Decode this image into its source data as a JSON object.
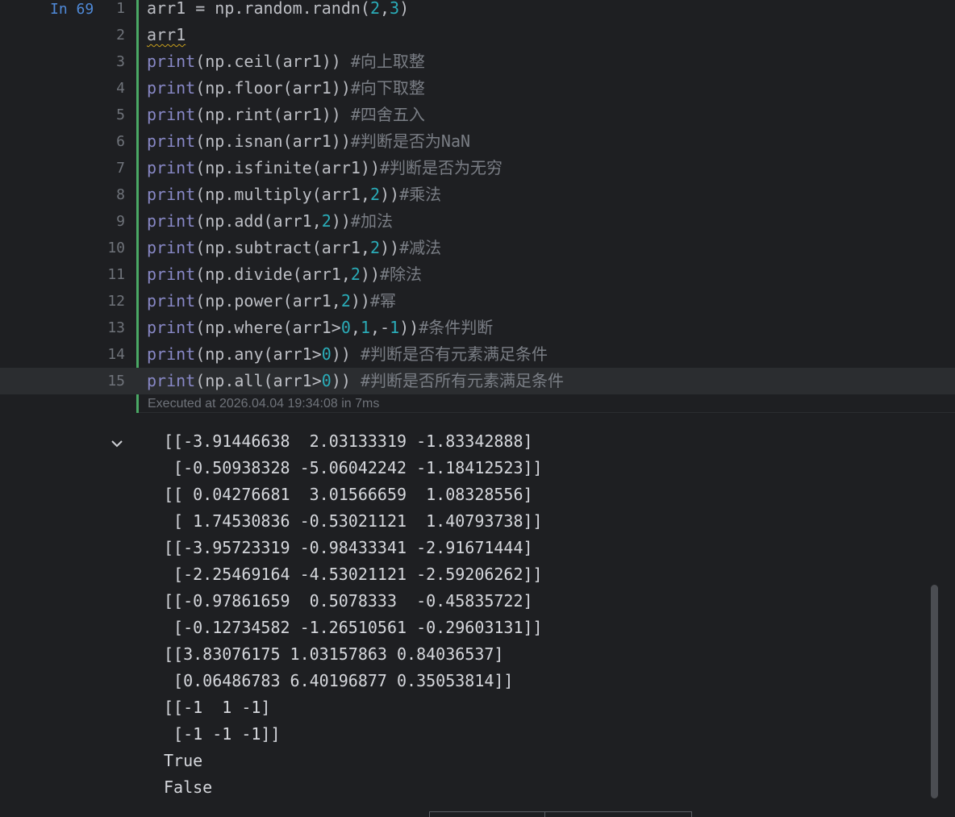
{
  "cell": {
    "label": "In 69",
    "execution_info": "Executed at 2026.04.04 19:34:08 in 7ms"
  },
  "code_lines": [
    {
      "no": "1",
      "code": "arr1 = np.random.randn(2,3)"
    },
    {
      "no": "2",
      "code": "arr1"
    },
    {
      "no": "3",
      "code": "print(np.ceil(arr1)) #向上取整"
    },
    {
      "no": "4",
      "code": "print(np.floor(arr1))#向下取整"
    },
    {
      "no": "5",
      "code": "print(np.rint(arr1)) #四舍五入"
    },
    {
      "no": "6",
      "code": "print(np.isnan(arr1))#判断是否为NaN"
    },
    {
      "no": "7",
      "code": "print(np.isfinite(arr1))#判断是否为无穷"
    },
    {
      "no": "8",
      "code": "print(np.multiply(arr1,2))#乘法"
    },
    {
      "no": "9",
      "code": "print(np.add(arr1,2))#加法"
    },
    {
      "no": "10",
      "code": "print(np.subtract(arr1,2))#减法"
    },
    {
      "no": "11",
      "code": "print(np.divide(arr1,2))#除法"
    },
    {
      "no": "12",
      "code": "print(np.power(arr1,2))#幂"
    },
    {
      "no": "13",
      "code": "print(np.where(arr1>0,1,-1))#条件判断"
    },
    {
      "no": "14",
      "code": "print(np.any(arr1>0)) #判断是否有元素满足条件"
    },
    {
      "no": "15",
      "code": "print(np.all(arr1>0)) #判断是否所有元素满足条件"
    }
  ],
  "output_lines": [
    "[[-3.91446638  2.03133319 -1.83342888]",
    " [-0.50938328 -5.06042242 -1.18412523]]",
    "[[ 0.04276681  3.01566659  1.08328556]",
    " [ 1.74530836 -0.53021121  1.40793738]]",
    "[[-3.95723319 -0.98433341 -2.91671444]",
    " [-2.25469164 -4.53021121 -2.59206262]]",
    "[[-0.97861659  0.5078333  -0.45835722]",
    " [-0.12734582 -1.26510561 -0.29603131]]",
    "[[3.83076175 1.03157863 0.84036537]",
    " [0.06486783 6.40196877 0.35053814]]",
    "[[-1  1 -1]",
    " [-1 -1 -1]]",
    "True",
    "False"
  ],
  "colors": {
    "background": "#1e1f22",
    "current_line": "#2b2d30",
    "cell_bar": "#4aa865",
    "keyword_print": "#8888c6",
    "number": "#2aacb8",
    "comment": "#7a7e85",
    "cell_label": "#4f8ad9"
  },
  "icons": {
    "collapse": "chevron-down-icon"
  }
}
